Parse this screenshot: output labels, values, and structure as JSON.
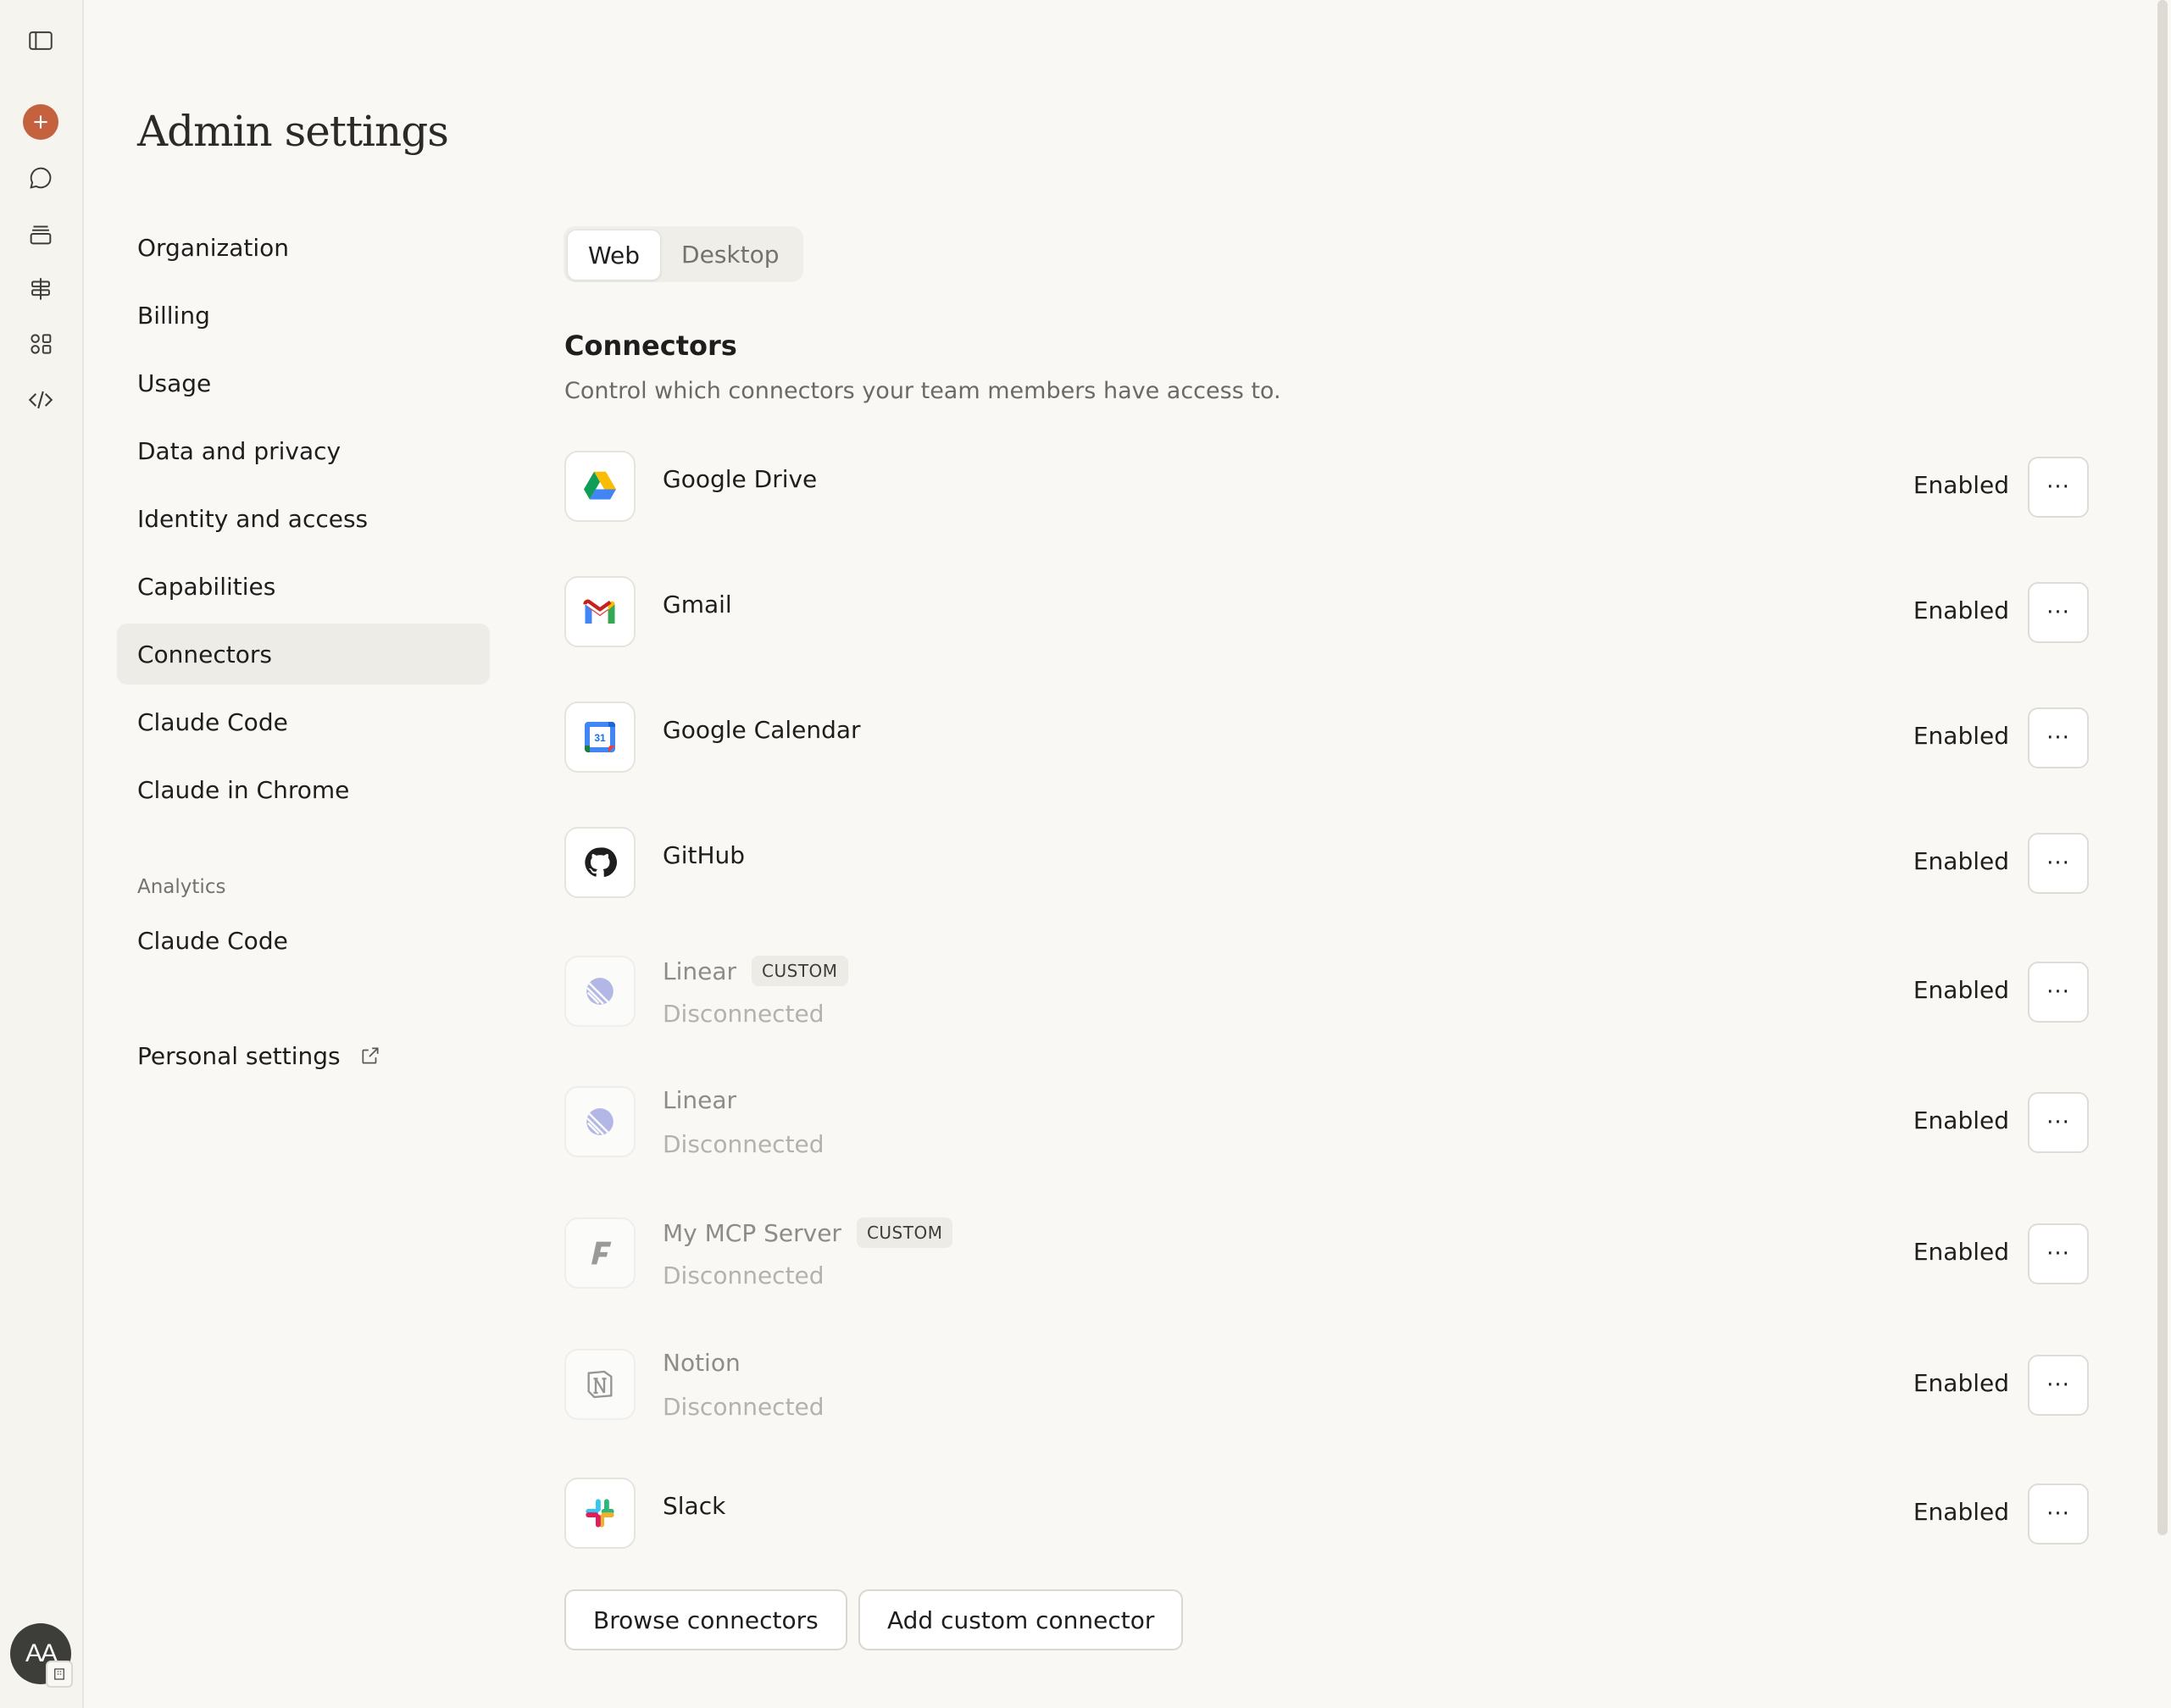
{
  "rail": {
    "items": [
      {
        "icon": "sidebar-toggle-icon"
      },
      {
        "icon": "plus-icon"
      },
      {
        "icon": "chat-bubble-icon"
      },
      {
        "icon": "projects-icon"
      },
      {
        "icon": "signpost-icon"
      },
      {
        "icon": "shapes-icon"
      },
      {
        "icon": "code-icon"
      }
    ],
    "accent": "#c6613f",
    "avatar_initials": "AA"
  },
  "page": {
    "title": "Admin settings"
  },
  "nav": {
    "items": [
      {
        "label": "Organization"
      },
      {
        "label": "Billing"
      },
      {
        "label": "Usage"
      },
      {
        "label": "Data and privacy"
      },
      {
        "label": "Identity and access"
      },
      {
        "label": "Capabilities"
      },
      {
        "label": "Connectors",
        "active": true
      },
      {
        "label": "Claude Code"
      },
      {
        "label": "Claude in Chrome"
      }
    ],
    "analytics_heading": "Analytics",
    "analytics_items": [
      {
        "label": "Claude Code"
      }
    ],
    "personal_settings": "Personal settings"
  },
  "tabs": [
    {
      "label": "Web",
      "active": true
    },
    {
      "label": "Desktop",
      "active": false
    }
  ],
  "section": {
    "title": "Connectors",
    "subtitle": "Control which connectors your team members have access to."
  },
  "connectors": [
    {
      "name": "Google Drive",
      "icon": "google-drive-icon",
      "state": "Enabled"
    },
    {
      "name": "Gmail",
      "icon": "gmail-icon",
      "state": "Enabled"
    },
    {
      "name": "Google Calendar",
      "icon": "google-calendar-icon",
      "state": "Enabled"
    },
    {
      "name": "GitHub",
      "icon": "github-icon",
      "state": "Enabled"
    },
    {
      "name": "Linear",
      "badge": "CUSTOM",
      "status": "Disconnected",
      "icon": "linear-icon",
      "state": "Enabled"
    },
    {
      "name": "Linear",
      "status": "Disconnected",
      "icon": "linear-icon",
      "state": "Enabled"
    },
    {
      "name": "My MCP Server",
      "badge": "CUSTOM",
      "status": "Disconnected",
      "icon": "mcp-server-icon",
      "state": "Enabled"
    },
    {
      "name": "Notion",
      "status": "Disconnected",
      "icon": "notion-icon",
      "state": "Enabled"
    },
    {
      "name": "Slack",
      "icon": "slack-icon",
      "state": "Enabled"
    }
  ],
  "more_label": "···",
  "calendar_day": "31",
  "footer": {
    "browse": "Browse connectors",
    "add_custom": "Add custom connector"
  }
}
